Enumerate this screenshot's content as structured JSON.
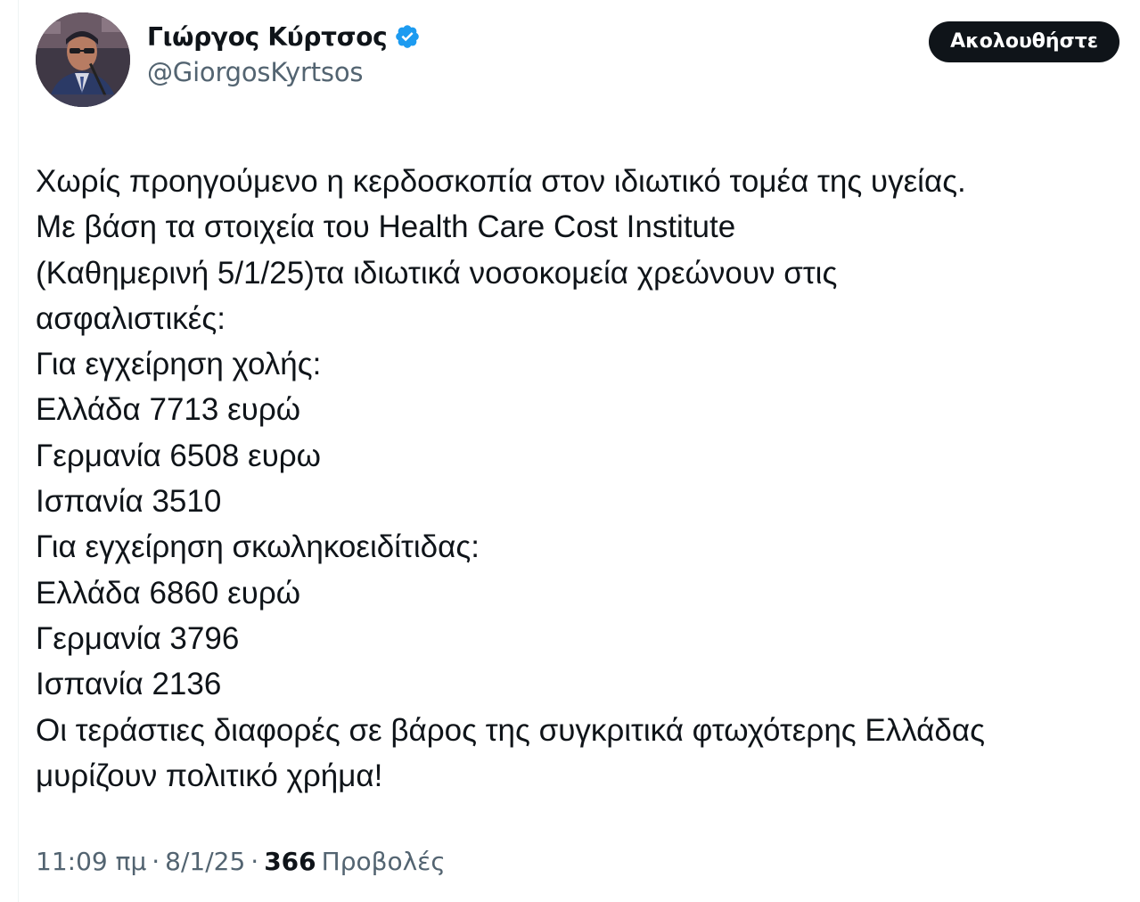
{
  "author": {
    "display_name": "Γιώργος Κύρτσος",
    "handle": "@GiorgosKyrtsos",
    "verified_icon": "verified-badge-icon",
    "verified_color": "#1d9bf0"
  },
  "follow_button": {
    "label": "Ακολουθήστε"
  },
  "tweet": {
    "lines": [
      "Χωρίς προηγούμενο η κερδοσκοπία στον ιδιωτικό τομέα της υγείας.",
      "Με βάση τα στοιχεία του Health Care Cost Institute",
      "(Καθημερινή 5/1/25)τα ιδιωτικά νοσοκομεία χρεώνουν στις",
      "ασφαλιστικές:",
      "Για εγχείρηση χολής:",
      "Ελλάδα 7713 ευρώ",
      "Γερμανία 6508 ευρω",
      "Ισπανία 3510",
      "Για εγχείρηση σκωληκοειδίτιδας:",
      "Ελλάδα 6860 ευρώ",
      "Γερμανία 3796",
      "Ισπανία 2136",
      "Οι τεράστιες διαφορές σε βάρος της συγκριτικά φτωχότερης Ελλάδας",
      "μυρίζουν πολιτικό χρήμα!"
    ]
  },
  "meta": {
    "time": "11:09 πμ",
    "separator": "·",
    "date": "8/1/25",
    "views_count": "366",
    "views_label": "Προβολές"
  }
}
